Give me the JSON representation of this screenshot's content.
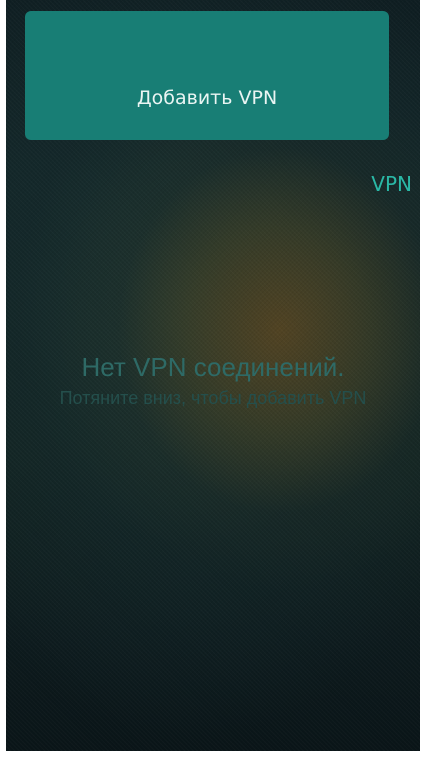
{
  "header": {
    "add_button_label": "Добавить VPN",
    "title": "VPN"
  },
  "empty_state": {
    "title": "Нет VPN соединений.",
    "hint": "Потяните вниз, чтобы добавить VPN"
  }
}
